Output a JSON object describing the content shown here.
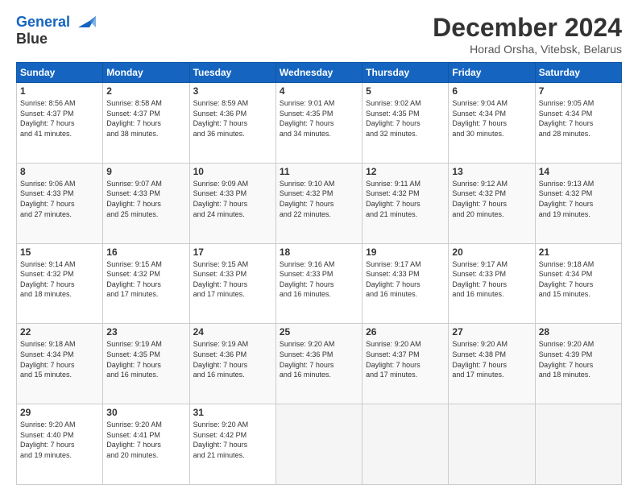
{
  "header": {
    "logo_line1": "General",
    "logo_line2": "Blue",
    "month_title": "December 2024",
    "subtitle": "Horad Orsha, Vitebsk, Belarus"
  },
  "days_of_week": [
    "Sunday",
    "Monday",
    "Tuesday",
    "Wednesday",
    "Thursday",
    "Friday",
    "Saturday"
  ],
  "weeks": [
    [
      {
        "day": "1",
        "info": "Sunrise: 8:56 AM\nSunset: 4:37 PM\nDaylight: 7 hours\nand 41 minutes."
      },
      {
        "day": "2",
        "info": "Sunrise: 8:58 AM\nSunset: 4:37 PM\nDaylight: 7 hours\nand 38 minutes."
      },
      {
        "day": "3",
        "info": "Sunrise: 8:59 AM\nSunset: 4:36 PM\nDaylight: 7 hours\nand 36 minutes."
      },
      {
        "day": "4",
        "info": "Sunrise: 9:01 AM\nSunset: 4:35 PM\nDaylight: 7 hours\nand 34 minutes."
      },
      {
        "day": "5",
        "info": "Sunrise: 9:02 AM\nSunset: 4:35 PM\nDaylight: 7 hours\nand 32 minutes."
      },
      {
        "day": "6",
        "info": "Sunrise: 9:04 AM\nSunset: 4:34 PM\nDaylight: 7 hours\nand 30 minutes."
      },
      {
        "day": "7",
        "info": "Sunrise: 9:05 AM\nSunset: 4:34 PM\nDaylight: 7 hours\nand 28 minutes."
      }
    ],
    [
      {
        "day": "8",
        "info": "Sunrise: 9:06 AM\nSunset: 4:33 PM\nDaylight: 7 hours\nand 27 minutes."
      },
      {
        "day": "9",
        "info": "Sunrise: 9:07 AM\nSunset: 4:33 PM\nDaylight: 7 hours\nand 25 minutes."
      },
      {
        "day": "10",
        "info": "Sunrise: 9:09 AM\nSunset: 4:33 PM\nDaylight: 7 hours\nand 24 minutes."
      },
      {
        "day": "11",
        "info": "Sunrise: 9:10 AM\nSunset: 4:32 PM\nDaylight: 7 hours\nand 22 minutes."
      },
      {
        "day": "12",
        "info": "Sunrise: 9:11 AM\nSunset: 4:32 PM\nDaylight: 7 hours\nand 21 minutes."
      },
      {
        "day": "13",
        "info": "Sunrise: 9:12 AM\nSunset: 4:32 PM\nDaylight: 7 hours\nand 20 minutes."
      },
      {
        "day": "14",
        "info": "Sunrise: 9:13 AM\nSunset: 4:32 PM\nDaylight: 7 hours\nand 19 minutes."
      }
    ],
    [
      {
        "day": "15",
        "info": "Sunrise: 9:14 AM\nSunset: 4:32 PM\nDaylight: 7 hours\nand 18 minutes."
      },
      {
        "day": "16",
        "info": "Sunrise: 9:15 AM\nSunset: 4:32 PM\nDaylight: 7 hours\nand 17 minutes."
      },
      {
        "day": "17",
        "info": "Sunrise: 9:15 AM\nSunset: 4:33 PM\nDaylight: 7 hours\nand 17 minutes."
      },
      {
        "day": "18",
        "info": "Sunrise: 9:16 AM\nSunset: 4:33 PM\nDaylight: 7 hours\nand 16 minutes."
      },
      {
        "day": "19",
        "info": "Sunrise: 9:17 AM\nSunset: 4:33 PM\nDaylight: 7 hours\nand 16 minutes."
      },
      {
        "day": "20",
        "info": "Sunrise: 9:17 AM\nSunset: 4:33 PM\nDaylight: 7 hours\nand 16 minutes."
      },
      {
        "day": "21",
        "info": "Sunrise: 9:18 AM\nSunset: 4:34 PM\nDaylight: 7 hours\nand 15 minutes."
      }
    ],
    [
      {
        "day": "22",
        "info": "Sunrise: 9:18 AM\nSunset: 4:34 PM\nDaylight: 7 hours\nand 15 minutes."
      },
      {
        "day": "23",
        "info": "Sunrise: 9:19 AM\nSunset: 4:35 PM\nDaylight: 7 hours\nand 16 minutes."
      },
      {
        "day": "24",
        "info": "Sunrise: 9:19 AM\nSunset: 4:36 PM\nDaylight: 7 hours\nand 16 minutes."
      },
      {
        "day": "25",
        "info": "Sunrise: 9:20 AM\nSunset: 4:36 PM\nDaylight: 7 hours\nand 16 minutes."
      },
      {
        "day": "26",
        "info": "Sunrise: 9:20 AM\nSunset: 4:37 PM\nDaylight: 7 hours\nand 17 minutes."
      },
      {
        "day": "27",
        "info": "Sunrise: 9:20 AM\nSunset: 4:38 PM\nDaylight: 7 hours\nand 17 minutes."
      },
      {
        "day": "28",
        "info": "Sunrise: 9:20 AM\nSunset: 4:39 PM\nDaylight: 7 hours\nand 18 minutes."
      }
    ],
    [
      {
        "day": "29",
        "info": "Sunrise: 9:20 AM\nSunset: 4:40 PM\nDaylight: 7 hours\nand 19 minutes."
      },
      {
        "day": "30",
        "info": "Sunrise: 9:20 AM\nSunset: 4:41 PM\nDaylight: 7 hours\nand 20 minutes."
      },
      {
        "day": "31",
        "info": "Sunrise: 9:20 AM\nSunset: 4:42 PM\nDaylight: 7 hours\nand 21 minutes."
      },
      null,
      null,
      null,
      null
    ]
  ]
}
